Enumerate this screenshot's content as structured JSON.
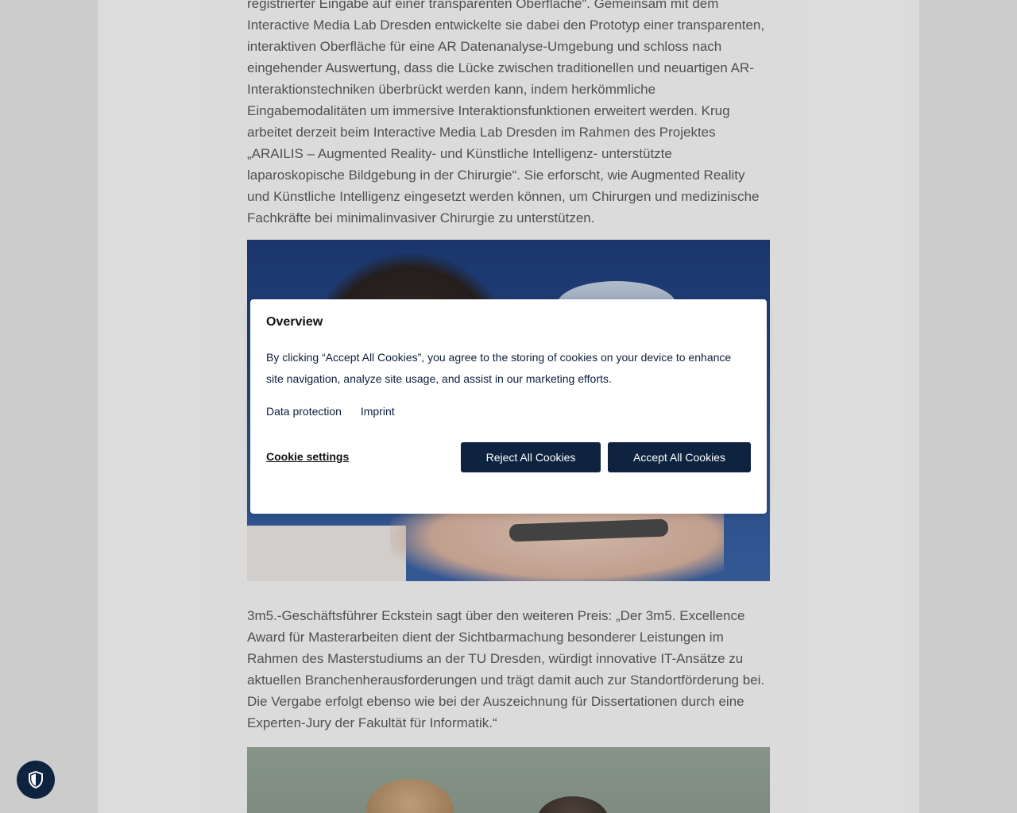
{
  "article": {
    "para1_lines": [
      "registrierter Eingabe auf einer transparenten Oberfläche“. Gemeinsam mit dem",
      "Interactive Media Lab Dresden entwickelte sie dabei den Prototyp einer transparenten,",
      "interaktiven Oberfläche für eine AR Datenanalyse-Umgebung und schloss nach",
      "eingehender Auswertung, dass die Lücke zwischen traditionellen und neuartigen AR-",
      "Interaktionstechniken überbrückt werden kann, indem herkömmliche",
      "Eingabemodalitäten um immersive Interaktionsfunktionen erweitert werden. Krug",
      "arbeitet derzeit beim Interactive Media Lab Dresden im Rahmen des Projektes",
      "„ARAILIS – Augmented Reality- und Künstliche Intelligenz- unterstützte",
      "laparoskopische Bildgebung in der Chirurgie“. Sie erforscht, wie Augmented Reality",
      "und Künstliche Intelligenz eingesetzt werden können, um Chirurgen und medizinische",
      "Fachkräfte bei minimalinvasiver Chirurgie zu unterstützen."
    ],
    "para2_lines": [
      "3m5.-Geschäftsführer Eckstein sagt über den weiteren Preis: „Der 3m5. Excellence",
      "Award für Masterarbeiten dient der Sichtbarmachung besonderer Leistungen im",
      "Rahmen des Masterstudiums an der TU Dresden, würdigt innovative IT-Ansätze zu",
      "aktuellen Branchenherausforderungen und trägt damit auch zur Standortförderung bei.",
      "Die Vergabe erfolgt ebenso wie bei der Auszeichnung für Dissertationen durch eine",
      "Experten-Jury der Fakultät für Informatik.“"
    ]
  },
  "cookie_dialog": {
    "title": "Overview",
    "text_lines": [
      "By clicking “Accept All Cookies”, you agree to the storing of cookies on your device to enhance",
      "site navigation, analyze site usage, and assist in our marketing efforts."
    ],
    "links": {
      "data_protection": "Data protection",
      "imprint": "Imprint"
    },
    "cookie_settings": "Cookie settings",
    "reject_button": "Reject All Cookies",
    "accept_button": "Accept All Cookies"
  },
  "privacy_button": {
    "icon": "shield-icon"
  },
  "colors": {
    "primary": "#0e2340",
    "body_text": "#5a5a5a",
    "background": "#e6e6e6"
  }
}
